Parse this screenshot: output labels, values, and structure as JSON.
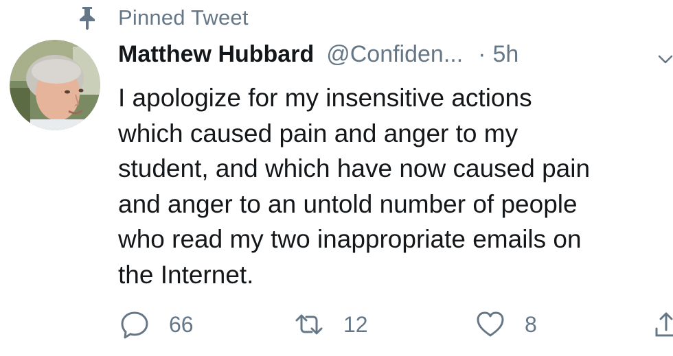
{
  "pinned": {
    "label": "Pinned Tweet",
    "icon": "pin-icon"
  },
  "author": {
    "display_name": "Matthew Hubbard",
    "handle": "@Confiden...",
    "separator": "·",
    "time": "5h"
  },
  "tweet": {
    "lines": [
      "I apologize for my insensitive actions",
      "which caused pain and anger to my",
      "student, and which have now caused pain",
      "and anger to an untold number of people",
      "who read my two inappropriate emails on",
      "the Internet."
    ]
  },
  "actions": {
    "reply_count": "66",
    "retweet_count": "12",
    "like_count": "8"
  },
  "colors": {
    "text": "#14171a",
    "muted": "#657786"
  }
}
